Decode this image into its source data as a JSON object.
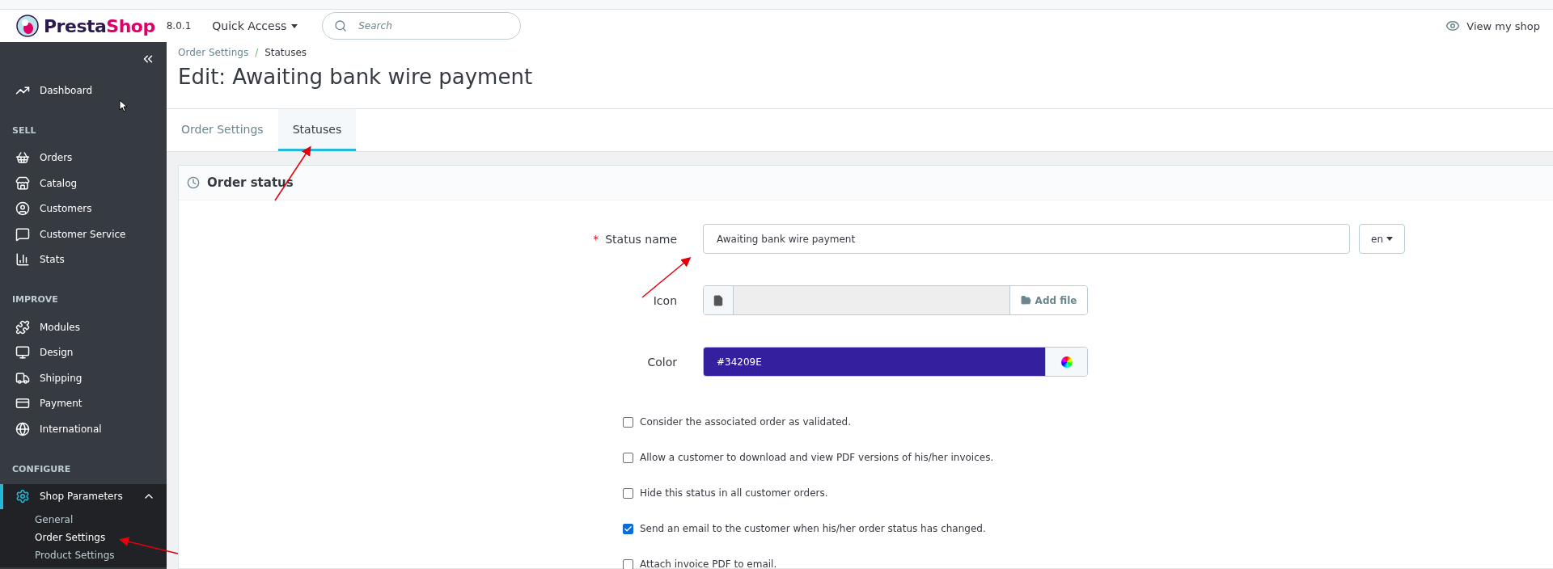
{
  "header": {
    "logo": [
      {
        "text": "Presta",
        "color": "#2d1a4d"
      },
      {
        "text": "Shop",
        "color": "#df0067"
      }
    ],
    "version": "8.0.1",
    "quick_access": "Quick Access",
    "search": {
      "placeholder": "Search"
    },
    "view_shop": "View my shop"
  },
  "sidebar": {
    "sections": [
      {
        "items": [
          {
            "label": "Dashboard",
            "selected": false,
            "expanded": false
          }
        ]
      },
      {
        "heading": "SELL",
        "items": [
          {
            "label": "Orders",
            "selected": false,
            "expanded": false
          },
          {
            "label": "Catalog",
            "selected": false,
            "expanded": false
          },
          {
            "label": "Customers",
            "selected": false,
            "expanded": false
          },
          {
            "label": "Customer Service",
            "selected": false,
            "expanded": false
          },
          {
            "label": "Stats",
            "selected": false,
            "expanded": false
          }
        ]
      },
      {
        "heading": "IMPROVE",
        "items": [
          {
            "label": "Modules",
            "selected": false,
            "expanded": false
          },
          {
            "label": "Design",
            "selected": false,
            "expanded": false
          },
          {
            "label": "Shipping",
            "selected": false,
            "expanded": false
          },
          {
            "label": "Payment",
            "selected": false,
            "expanded": false
          },
          {
            "label": "International",
            "selected": false,
            "expanded": false
          }
        ]
      },
      {
        "heading": "CONFIGURE",
        "items": [
          {
            "label": "Shop Parameters",
            "selected": true,
            "expanded": true,
            "children": [
              {
                "label": "General",
                "selected": false
              },
              {
                "label": "Order Settings",
                "selected": true
              },
              {
                "label": "Product Settings",
                "selected": false
              }
            ]
          }
        ]
      }
    ]
  },
  "breadcrumb": {
    "items": [
      "Order Settings",
      "Statuses"
    ],
    "separator": "/"
  },
  "title": "Edit: Awaiting bank wire payment",
  "tabs": [
    {
      "label": "Order Settings",
      "selected": false
    },
    {
      "label": "Statuses",
      "selected": true
    }
  ],
  "panel": {
    "title": "Order status",
    "fields": [
      {
        "kind": "text",
        "label": "Status name",
        "required": true,
        "required_mark": "*",
        "value": "Awaiting bank wire payment",
        "language": "en"
      },
      {
        "kind": "file",
        "label": "Icon",
        "required": false,
        "button": "Add file"
      },
      {
        "kind": "color",
        "label": "Color",
        "required": false,
        "value": "#34209E",
        "color": "#34209e"
      }
    ],
    "checkboxes": [
      {
        "label": "Consider the associated order as validated.",
        "checked": false
      },
      {
        "label": "Allow a customer to download and view PDF versions of his/her invoices.",
        "checked": false
      },
      {
        "label": "Hide this status in all customer orders.",
        "checked": false
      },
      {
        "label": "Send an email to the customer when his/her order status has changed.",
        "checked": true
      },
      {
        "label": "Attach invoice PDF to email.",
        "checked": false
      }
    ]
  }
}
